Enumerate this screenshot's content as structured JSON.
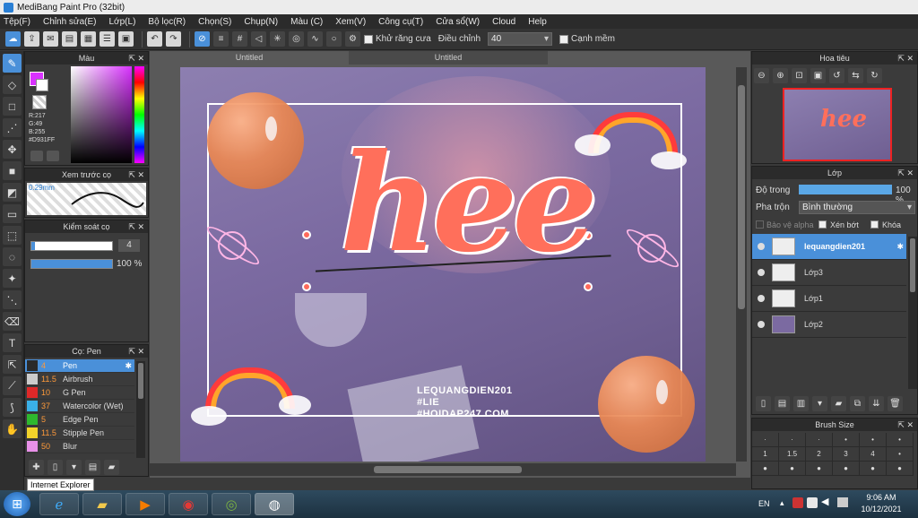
{
  "app": {
    "title": "MediBang Paint Pro (32bit)"
  },
  "menu": [
    "Tệp(F)",
    "Chỉnh sửa(E)",
    "Lớp(L)",
    "Bộ lọc(R)",
    "Chọn(S)",
    "Chụp(N)",
    "Màu (C)",
    "Xem(V)",
    "Công cụ(T)",
    "Cửa sổ(W)",
    "Cloud",
    "Help"
  ],
  "toolbar": {
    "antialias_label": "Khử răng cưa",
    "adjust_label": "Điều chỉnh",
    "adjust_value": "40",
    "edge_label": "Cạnh mềm"
  },
  "color_panel": {
    "title": "Màu",
    "rgb": [
      "R:217",
      "G:49",
      "B:255"
    ],
    "hex": "#D931FF",
    "fg_color": "#D931FF"
  },
  "preview_panel": {
    "title": "Xem trước cọ",
    "size": "0.29mm"
  },
  "brush_control": {
    "title": "Kiểm soát cọ",
    "size_value": "4",
    "opacity_value": "100 %"
  },
  "brush_panel": {
    "title": "Cọ: Pen",
    "items": [
      {
        "size": "4",
        "name": "Pen",
        "color": "#2a2a2a"
      },
      {
        "size": "11.5",
        "name": "Airbrush",
        "color": "#cccccc"
      },
      {
        "size": "10",
        "name": "G Pen",
        "color": "#e02828"
      },
      {
        "size": "37",
        "name": "Watercolor (Wet)",
        "color": "#3ab0e8"
      },
      {
        "size": "5",
        "name": "Edge Pen",
        "color": "#2eb82e"
      },
      {
        "size": "11.5",
        "name": "Stipple Pen",
        "color": "#f2d32a"
      },
      {
        "size": "50",
        "name": "Blur",
        "color": "#e891e8"
      }
    ]
  },
  "tabs": [
    "Untitled",
    "Untitled"
  ],
  "artwork": {
    "title": "hee",
    "watermark": [
      "LEQUANGDIEN201",
      "#LIE",
      "#HOIDAP247.COM"
    ]
  },
  "navigator": {
    "title": "Hoa tiêu"
  },
  "layers_panel": {
    "title": "Lớp",
    "opacity_label": "Độ trong",
    "opacity_value": "100 %",
    "blend_label": "Pha trộn",
    "blend_value": "Bình thường",
    "protect_alpha": "Bảo vệ alpha",
    "clipping": "Xén bớt",
    "lock": "Khóa",
    "layers": [
      "lequangdien201",
      "Lớp3",
      "Lớp1",
      "Lớp2"
    ]
  },
  "brush_size_panel": {
    "title": "Brush Size",
    "sizes": [
      "1",
      "1.5",
      "2",
      "3",
      "4"
    ]
  },
  "tooltip": "Internet Explorer",
  "taskbar": {
    "lang": "EN",
    "time": "9:06 AM",
    "date": "10/12/2021"
  }
}
